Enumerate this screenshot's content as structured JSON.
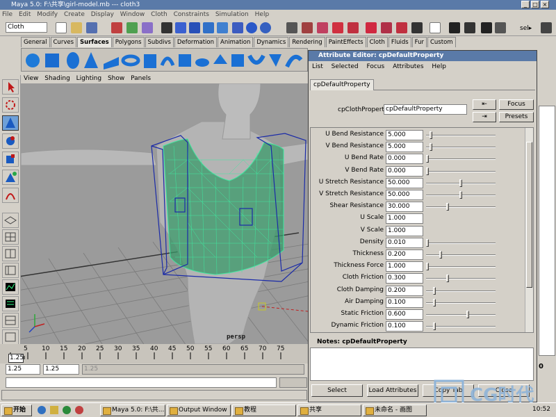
{
  "window": {
    "title": "Maya 5.0: F:\\共享\\girl-model.mb  ---  cloth3"
  },
  "menubar": [
    "File",
    "Edit",
    "Modify",
    "Create",
    "Display",
    "Window",
    "Cloth",
    "Constraints",
    "Simulation",
    "Help"
  ],
  "toolbar": {
    "mode_select": "Cloth",
    "sel_label": "sel▸"
  },
  "shelf_tabs": [
    "General",
    "Curves",
    "Surfaces",
    "Polygons",
    "Subdivs",
    "Deformation",
    "Animation",
    "Dynamics",
    "Rendering",
    "PaintEffects",
    "Cloth",
    "Fluids",
    "Fur",
    "Custom"
  ],
  "shelf_selected": "Surfaces",
  "panel_menu": [
    "View",
    "Shading",
    "Lighting",
    "Show",
    "Panels"
  ],
  "viewport": {
    "camera_label": "persp"
  },
  "timeline": {
    "ticks": [
      "5",
      "10",
      "15",
      "20",
      "25",
      "30",
      "35",
      "40",
      "45",
      "50",
      "55",
      "60",
      "65",
      "70",
      "75"
    ],
    "current_frame": "1.25"
  },
  "range": {
    "start": "1.25",
    "end": "1.25",
    "range_end": "1.25"
  },
  "attribute_editor": {
    "title": "Attribute Editor: cpDefaultProperty",
    "menu": [
      "List",
      "Selected",
      "Focus",
      "Attributes",
      "Help"
    ],
    "tab": "cpDefaultProperty",
    "node_label": "cpClothProperty:",
    "node_value": "cpDefaultProperty",
    "focus_button": "Focus",
    "presets_button": "Presets",
    "attributes": [
      {
        "label": "U Bend Resistance",
        "value": "5.000",
        "slider": 0.05
      },
      {
        "label": "V Bend Resistance",
        "value": "5.000",
        "slider": 0.05
      },
      {
        "label": "U Bend Rate",
        "value": "0.000",
        "slider": 0.0
      },
      {
        "label": "V Bend Rate",
        "value": "0.000",
        "slider": 0.0
      },
      {
        "label": "U Stretch Resistance",
        "value": "50.000",
        "slider": 0.5
      },
      {
        "label": "V Stretch Resistance",
        "value": "50.000",
        "slider": 0.5
      },
      {
        "label": "Shear Resistance",
        "value": "30.000",
        "slider": 0.3
      },
      {
        "label": "U Scale",
        "value": "1.000",
        "slider": null
      },
      {
        "label": "V Scale",
        "value": "1.000",
        "slider": null
      },
      {
        "label": "Density",
        "value": "0.010",
        "slider": 0.0
      },
      {
        "label": "Thickness",
        "value": "0.200",
        "slider": 0.2
      },
      {
        "label": "Thickness Force",
        "value": "1.000",
        "slider": 0.0
      },
      {
        "label": "Cloth Friction",
        "value": "0.300",
        "slider": 0.3
      },
      {
        "label": "Cloth Damping",
        "value": "0.200",
        "slider": 0.1
      },
      {
        "label": "Air Damping",
        "value": "0.100",
        "slider": 0.1
      },
      {
        "label": "Static Friction",
        "value": "0.600",
        "slider": 0.6
      },
      {
        "label": "Dynamic Friction",
        "value": "0.100",
        "slider": 0.1
      }
    ],
    "notes_label": "Notes: cpDefaultProperty",
    "buttons": [
      "Select",
      "Load Attributes",
      "Copy Tab",
      "Close"
    ]
  },
  "taskbar": {
    "start": "开始",
    "tasks": [
      "Maya 5.0: F:\\共...",
      "Output Window",
      "教程",
      "共享",
      "未命名 - 画图"
    ],
    "clock": "10:52"
  },
  "watermark": {
    "text": "CG时代"
  },
  "colors": {
    "titlebar": "#5a7aa8",
    "viewport_bg": "#9b9b9b",
    "mesh_wire": "#3fe8a0",
    "cage": "#1a2aa8"
  }
}
